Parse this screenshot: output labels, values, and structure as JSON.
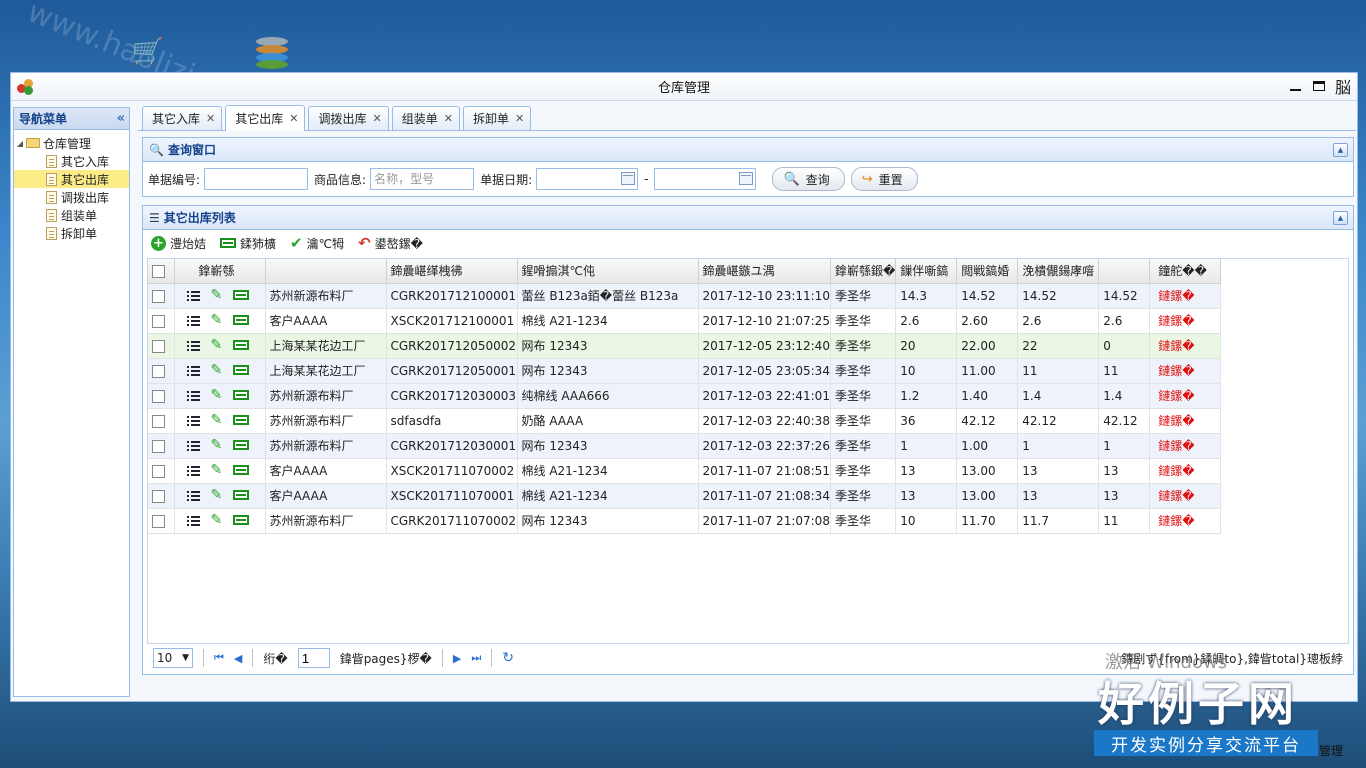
{
  "window": {
    "title": "仓库管理",
    "ctrl_extra": "脳"
  },
  "nav": {
    "title": "导航菜单",
    "root": "仓库管理",
    "items": [
      "其它入库",
      "其它出库",
      "调拨出库",
      "组装单",
      "拆卸单"
    ],
    "selected_index": 1
  },
  "tabs": [
    "其它入库",
    "其它出库",
    "调拨出库",
    "组装单",
    "拆卸单"
  ],
  "active_tab_index": 1,
  "query": {
    "title": "查询窗口",
    "doc_no_label": "单据编号:",
    "doc_no_value": "",
    "goods_label": "商品信息:",
    "goods_placeholder": "名称，型号",
    "date_label": "单据日期:",
    "date_sep": "-",
    "search_btn": "查询",
    "reset_btn": "重置"
  },
  "list": {
    "title": "其它出库列表",
    "toolbar": [
      "澧炲姞",
      "鍒犻櫎",
      "瀹℃牳",
      "鍙嶅鏍�"
    ],
    "columns": [
      "鎿嶄綔",
      "",
      "鍗曟嵁缂栧彿",
      "鍟嗗搧淇℃伅",
      "鍗曟嵁鏃ユ湡",
      "鎿嶄綔鍛�",
      "鏁伴噺鎬",
      "閲戦鎬婚",
      "浼樻儬鍚庨噾",
      "",
      "鐘舵��"
    ],
    "rows": [
      {
        "org": "苏州新源布料厂",
        "no": "CGRK201712100001",
        "goods": "蕾丝 B123a銆�蕾丝 B123a",
        "date": "2017-12-10 23:11:10",
        "op": "季圣华",
        "qty": "14.3",
        "amt": "14.52",
        "disc": "14.52",
        "v": "14.52",
        "status": "鏈鏍�"
      },
      {
        "org": "客户AAAA",
        "no": "XSCK201712100001",
        "goods": "棉线 A21-1234",
        "date": "2017-12-10 21:07:25",
        "op": "季圣华",
        "qty": "2.6",
        "amt": "2.60",
        "disc": "2.6",
        "v": "2.6",
        "status": "鏈鏍�"
      },
      {
        "org": "上海某某花边工厂",
        "no": "CGRK201712050002",
        "goods": "网布 12343",
        "date": "2017-12-05 23:12:40",
        "op": "季圣华",
        "qty": "20",
        "amt": "22.00",
        "disc": "22",
        "v": "0",
        "status": "鏈鏍�"
      },
      {
        "org": "上海某某花边工厂",
        "no": "CGRK201712050001",
        "goods": "网布 12343",
        "date": "2017-12-05 23:05:34",
        "op": "季圣华",
        "qty": "10",
        "amt": "11.00",
        "disc": "11",
        "v": "11",
        "status": "鏈鏍�"
      },
      {
        "org": "苏州新源布料厂",
        "no": "CGRK201712030003",
        "goods": "纯棉线 AAA666",
        "date": "2017-12-03 22:41:01",
        "op": "季圣华",
        "qty": "1.2",
        "amt": "1.40",
        "disc": "1.4",
        "v": "1.4",
        "status": "鏈鏍�"
      },
      {
        "org": "苏州新源布料厂",
        "no": "sdfasdfa",
        "goods": "奶酪 AAAA",
        "date": "2017-12-03 22:40:38",
        "op": "季圣华",
        "qty": "36",
        "amt": "42.12",
        "disc": "42.12",
        "v": "42.12",
        "status": "鏈鏍�"
      },
      {
        "org": "苏州新源布料厂",
        "no": "CGRK201712030001",
        "goods": "网布 12343",
        "date": "2017-12-03 22:37:26",
        "op": "季圣华",
        "qty": "1",
        "amt": "1.00",
        "disc": "1",
        "v": "1",
        "status": "鏈鏍�"
      },
      {
        "org": "客户AAAA",
        "no": "XSCK201711070002",
        "goods": "棉线 A21-1234",
        "date": "2017-11-07 21:08:51",
        "op": "季圣华",
        "qty": "13",
        "amt": "13.00",
        "disc": "13",
        "v": "13",
        "status": "鏈鏍�"
      },
      {
        "org": "客户AAAA",
        "no": "XSCK201711070001",
        "goods": "棉线 A21-1234",
        "date": "2017-11-07 21:08:34",
        "op": "季圣华",
        "qty": "13",
        "amt": "13.00",
        "disc": "13",
        "v": "13",
        "status": "鏈鏍�"
      },
      {
        "org": "苏州新源布料厂",
        "no": "CGRK201711070002",
        "goods": "网布 12343",
        "date": "2017-11-07 21:07:08",
        "op": "季圣华",
        "qty": "10",
        "amt": "11.70",
        "disc": "11.7",
        "v": "11",
        "status": "鏈鏍�"
      }
    ]
  },
  "pager": {
    "page_size": "10",
    "before_input": "绗�",
    "page_value": "1",
    "after_input": "鍏眥pages}椤�",
    "info": "鏄剧ず{from}鍒皗to},鍏眥total}璁板綍"
  },
  "overlay": {
    "watermark": "www.haolizi.com",
    "activate": "激活 Windows",
    "logo": "好例子网",
    "slogan": "开发实例分享交流平台",
    "taskbar": "管理"
  }
}
